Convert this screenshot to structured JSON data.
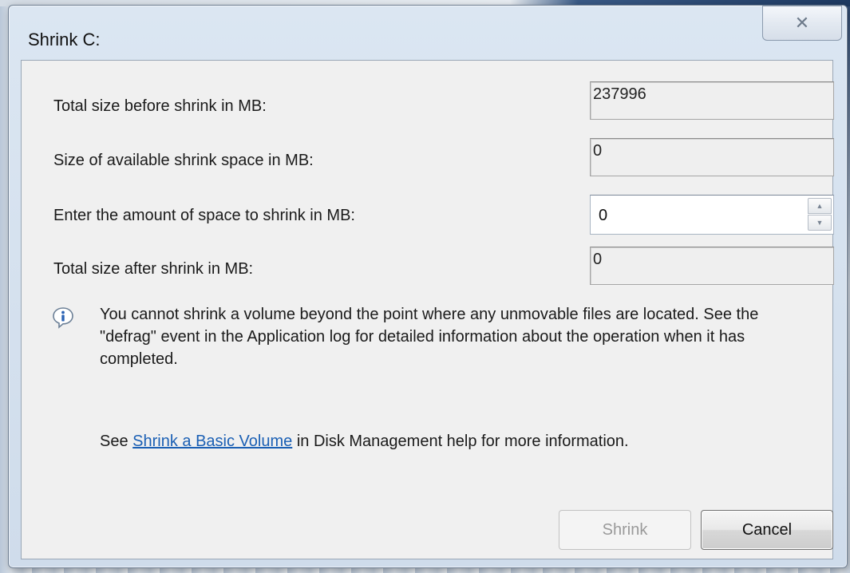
{
  "window": {
    "title": "Shrink C:",
    "close_glyph": "✕"
  },
  "fields": {
    "total_before_label": "Total size before shrink in MB:",
    "total_before_value": "237996",
    "available_label": "Size of available shrink space in MB:",
    "available_value": "0",
    "amount_label": "Enter the amount of space to shrink in MB:",
    "amount_value": "0",
    "total_after_label": "Total size after shrink in MB:",
    "total_after_value": "0"
  },
  "info": {
    "icon": "info-balloon-icon",
    "message": "You cannot shrink a volume beyond the point where any unmovable files are located. See the \"defrag\" event in the Application log for detailed information about the operation when it has completed."
  },
  "help": {
    "prefix": "See ",
    "link_text": "Shrink a Basic Volume",
    "suffix": " in Disk Management help for more information."
  },
  "buttons": {
    "shrink_label": "Shrink",
    "shrink_enabled": false,
    "cancel_label": "Cancel"
  },
  "colors": {
    "link": "#1a5fb4",
    "disabled_text": "#9a9a9a"
  }
}
